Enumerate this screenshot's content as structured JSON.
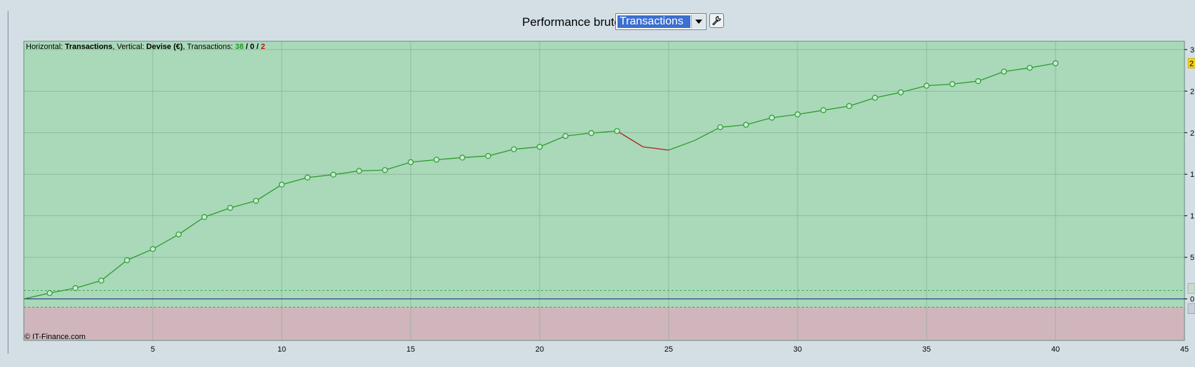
{
  "header": {
    "label": "Performance brute",
    "select_value": "Transactions",
    "select_arrow_icon": "chevron-down-icon",
    "settings_icon": "wrench-icon"
  },
  "info": {
    "horizontal_label": "Horizontal: ",
    "horizontal_value": "Transactions",
    "vertical_label": ", Vertical: ",
    "vertical_value": "Devise (€)",
    "transactions_label": ", Transactions: ",
    "count_win": "38",
    "sep1": " / ",
    "count_even": "0",
    "sep2": " / ",
    "count_loss": "2"
  },
  "copyright": "© IT-Finance.com",
  "colors": {
    "plot_green": "#a9d9b9",
    "plot_red": "#d0b6bc",
    "line_up": "#2e9b2e",
    "line_down": "#b01d1d",
    "zero_line": "#24357f",
    "win_text": "#1f9a1f",
    "loss_text": "#c01010",
    "badge": "#f2d21a"
  },
  "chart_data": {
    "type": "line",
    "xlabel": "",
    "ylabel": "",
    "xlim": [
      0,
      45
    ],
    "ylim": [
      -0.5,
      3.1
    ],
    "x_ticks": [
      "5",
      "10",
      "15",
      "20",
      "25",
      "30",
      "35",
      "40",
      "45"
    ],
    "y_tick_labels": [
      "3",
      "2",
      "2",
      "1",
      "1",
      "5",
      "0"
    ],
    "y_badge": "2",
    "grid": true,
    "x": [
      0,
      1,
      2,
      3,
      4,
      5,
      6,
      7,
      8,
      9,
      10,
      11,
      12,
      13,
      14,
      15,
      16,
      17,
      18,
      19,
      20,
      21,
      22,
      23,
      24,
      25,
      26,
      27,
      28,
      29,
      30,
      31,
      32,
      33,
      34,
      35,
      36,
      37,
      38,
      39,
      40
    ],
    "values": [
      0.0,
      0.07,
      0.13,
      0.22,
      0.465,
      0.6,
      0.775,
      0.985,
      1.095,
      1.18,
      1.375,
      1.46,
      1.495,
      1.54,
      1.55,
      1.645,
      1.675,
      1.7,
      1.72,
      1.8,
      1.83,
      1.96,
      1.995,
      2.02,
      1.83,
      1.79,
      1.905,
      2.065,
      2.095,
      2.18,
      2.22,
      2.27,
      2.32,
      2.42,
      2.485,
      2.565,
      2.585,
      2.62,
      2.735,
      2.78,
      2.835
    ],
    "trade_result": [
      "",
      "win",
      "win",
      "win",
      "win",
      "win",
      "win",
      "win",
      "win",
      "win",
      "win",
      "win",
      "win",
      "win",
      "win",
      "win",
      "win",
      "win",
      "win",
      "win",
      "win",
      "win",
      "win",
      "win",
      "loss",
      "loss",
      "win",
      "win",
      "win",
      "win",
      "win",
      "win",
      "win",
      "win",
      "win",
      "win",
      "win",
      "win",
      "win",
      "win",
      "win"
    ],
    "markers": [
      false,
      true,
      true,
      true,
      true,
      true,
      true,
      true,
      true,
      true,
      true,
      true,
      true,
      true,
      true,
      true,
      true,
      true,
      true,
      true,
      true,
      true,
      true,
      true,
      false,
      false,
      false,
      true,
      true,
      true,
      true,
      true,
      true,
      true,
      true,
      true,
      true,
      true,
      true,
      true,
      true
    ]
  }
}
